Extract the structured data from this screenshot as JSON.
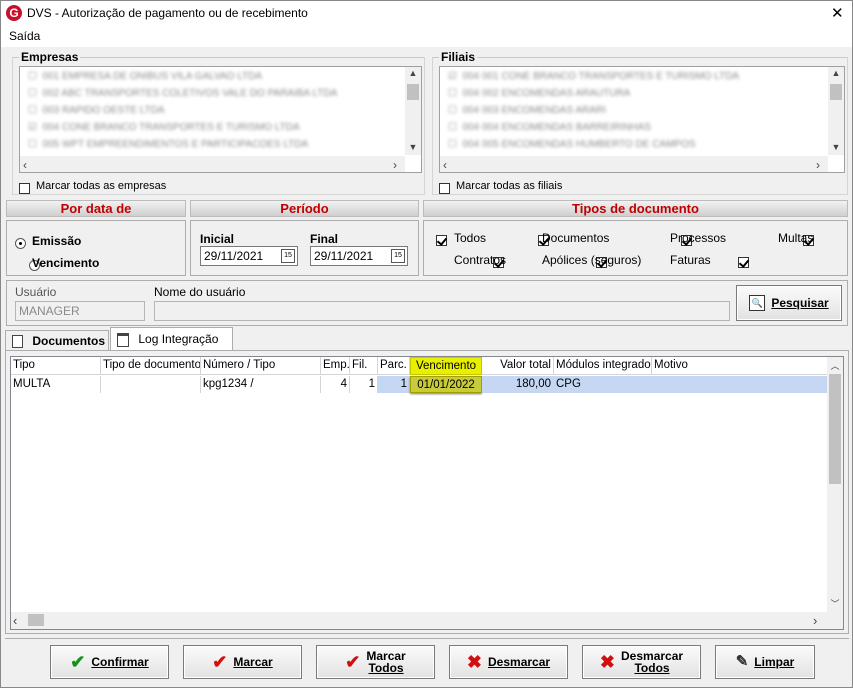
{
  "window": {
    "title": "DVS - Autorização de pagamento ou de recebimento",
    "app_icon": "G",
    "close": "✕"
  },
  "menu": {
    "saida": "Saída"
  },
  "empresas": {
    "title": "Empresas",
    "mark_all": "Marcar todas as empresas"
  },
  "filiais": {
    "title": "Filiais",
    "mark_all": "Marcar todas as filiais"
  },
  "por_data": {
    "title": "Por data de",
    "emissao": "Emissão",
    "vencimento": "Vencimento",
    "selected": "emissao"
  },
  "periodo": {
    "title": "Período",
    "inicial_label": "Inicial",
    "inicial_value": "29/11/2021",
    "final_label": "Final",
    "final_value": "29/11/2021",
    "cal_glyph": "15"
  },
  "tipos": {
    "title": "Tipos de documento",
    "items": [
      {
        "label": "Todos",
        "checked": true
      },
      {
        "label": "Documentos",
        "checked": true
      },
      {
        "label": "Processos",
        "checked": true
      },
      {
        "label": "Multas",
        "checked": true
      },
      {
        "label": "Contratos",
        "checked": true
      },
      {
        "label": "Apólices (seguros)",
        "checked": true
      },
      {
        "label": "Faturas",
        "checked": true
      }
    ]
  },
  "usuario": {
    "label": "Usuário",
    "value": "MANAGER",
    "nome_label": "Nome do usuário",
    "nome_value": "",
    "search_button": "Pesquisar"
  },
  "tabs": {
    "documentos": "Documentos",
    "log": "Log Integração",
    "active": "log"
  },
  "grid": {
    "columns": [
      "Tipo",
      "Tipo de documento",
      "Número / Tipo",
      "Emp.",
      "Fil.",
      "Parc.",
      "Vencimento",
      "Valor total",
      "Módulos integrados",
      "Motivo"
    ],
    "rows": [
      [
        "MULTA",
        "",
        "kpg1234 /",
        "4",
        "1",
        "1",
        "01/01/2022",
        "180,00",
        "CPG",
        ""
      ]
    ],
    "highlight_color": "#e8f000"
  },
  "buttons": {
    "confirmar": "Confirmar",
    "marcar": "Marcar",
    "marcar_todos_1": "Marcar",
    "marcar_todos_2": "Todos",
    "desmarcar": "Desmarcar",
    "desmarcar_todos_1": "Desmarcar",
    "desmarcar_todos_2": "Todos",
    "limpar": "Limpar"
  },
  "colors": {
    "header_red": "#c00000",
    "check_green": "#1a8f1a",
    "cross_red": "#d01010",
    "selection_blue": "#c5d7f2"
  }
}
